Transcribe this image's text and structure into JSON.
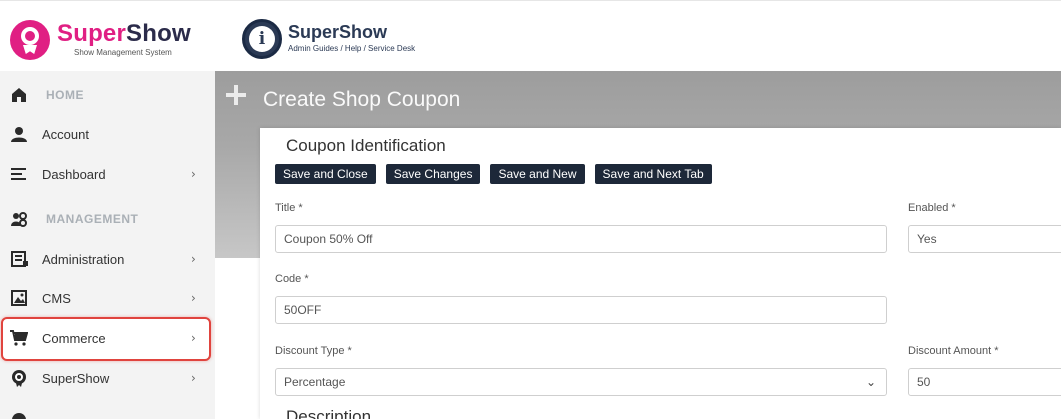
{
  "header": {
    "brand_part1": "Super",
    "brand_part2": "Show",
    "brand_sub": "Show Management System",
    "help_name": "SuperShow",
    "help_sub": "Admin Guides / Help / Service Desk",
    "help_glyph": "i"
  },
  "sidebar": {
    "items": [
      {
        "label": "HOME",
        "icon": "home-icon",
        "section": true
      },
      {
        "label": "Account",
        "icon": "user-icon"
      },
      {
        "label": "Dashboard",
        "icon": "menu-lines-icon",
        "chevron": true
      },
      {
        "label": "MANAGEMENT",
        "icon": "users-gear-icon",
        "section": true
      },
      {
        "label": "Administration",
        "icon": "admin-list-icon",
        "chevron": true
      },
      {
        "label": "CMS",
        "icon": "image-frame-icon",
        "chevron": true
      },
      {
        "label": "Commerce",
        "icon": "cart-icon",
        "chevron": true,
        "highlighted": true
      },
      {
        "label": "SuperShow",
        "icon": "supershow-icon",
        "chevron": true
      }
    ],
    "chevron_glyph": "›"
  },
  "main": {
    "page_title": "Create Shop Coupon",
    "section_title": "Coupon Identification",
    "buttons": [
      "Save and Close",
      "Save Changes",
      "Save and New",
      "Save and Next Tab"
    ],
    "fields": {
      "title_label": "Title *",
      "title_value": "Coupon 50% Off",
      "enabled_label": "Enabled *",
      "enabled_value": "Yes",
      "code_label": "Code *",
      "code_value": "50OFF",
      "discount_type_label": "Discount Type *",
      "discount_type_value": "Percentage",
      "discount_amount_label": "Discount Amount *",
      "discount_amount_value": "50"
    },
    "next_section_title": "Description",
    "select_arrow_glyph": "⌄"
  },
  "colors": {
    "brand_pink": "#e01f83",
    "button_dark": "#1d2839",
    "highlight_red": "#e0443e"
  }
}
